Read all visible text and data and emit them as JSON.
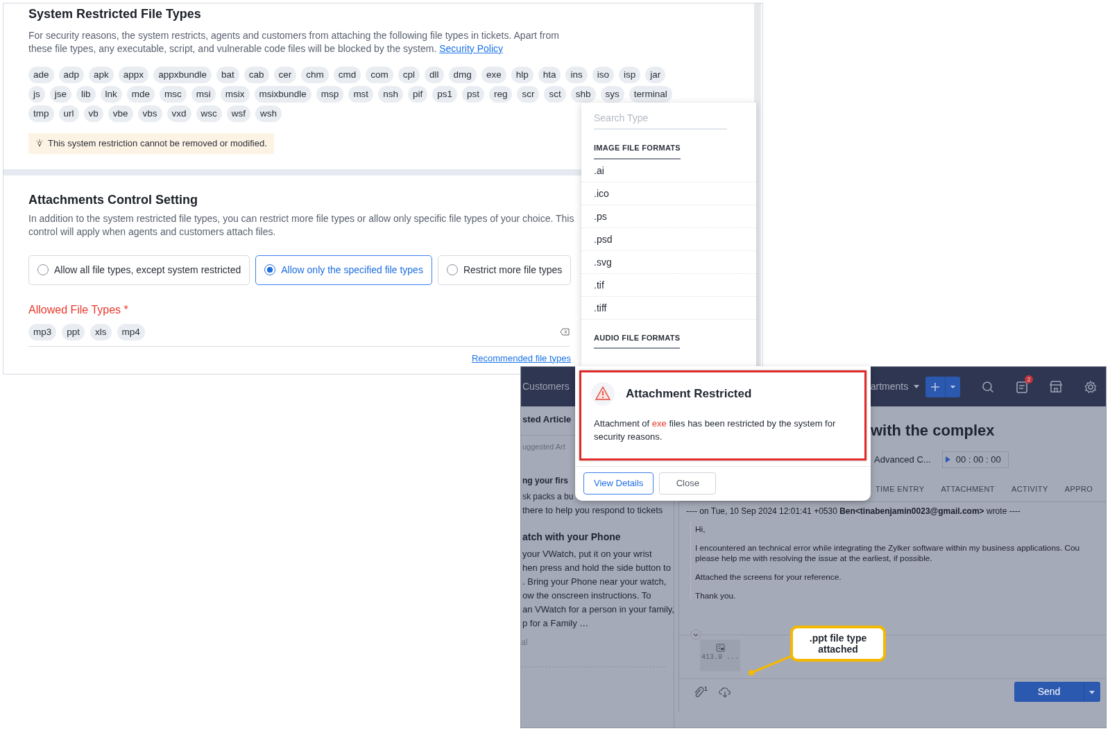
{
  "settings_panel": {
    "system_restricted": {
      "title": "System Restricted File Types",
      "description": "For security reasons, the system restricts, agents and customers from attaching the following file types in tickets. Apart from these file types, any executable, script, and vulnerable code files will be blocked by the system.",
      "link": "Security Policy",
      "file_type_rows": [
        [
          "ade",
          "adp",
          "apk",
          "appx",
          "appxbundle",
          "bat",
          "cab",
          "cer",
          "chm",
          "cmd",
          "com",
          "cpl",
          "dll",
          "dmg",
          "exe",
          "hlp",
          "hta",
          "ins",
          "iso",
          "isp",
          "jar"
        ],
        [
          "js",
          "jse",
          "lib",
          "lnk",
          "mde",
          "msc",
          "msi",
          "msix",
          "msixbundle",
          "msp",
          "mst",
          "nsh",
          "pif",
          "ps1",
          "pst",
          "reg",
          "scr",
          "sct",
          "shb",
          "sys",
          "terminal"
        ],
        [
          "tmp",
          "url",
          "vb",
          "vbe",
          "vbs",
          "vxd",
          "wsc",
          "wsf",
          "wsh"
        ]
      ],
      "notice": "This system restriction cannot be removed or modified."
    },
    "attachments_control": {
      "title": "Attachments Control Setting",
      "description": "In addition to the system restricted file types, you can restrict more file types or allow only specific file types of your choice. This control will apply when agents and customers attach files.",
      "options": [
        {
          "label": "Allow all file types, except system restricted",
          "selected": false
        },
        {
          "label": "Allow only the specified file types",
          "selected": true
        },
        {
          "label": "Restrict more file types",
          "selected": false
        }
      ],
      "allowed_label": "Allowed File Types",
      "required_mark": "*",
      "allowed_types": [
        "mp3",
        "ppt",
        "xls",
        "mp4"
      ],
      "recommended_link": "Recommended file types"
    }
  },
  "type_dropdown": {
    "placeholder": "Search Type",
    "groups": [
      {
        "heading": "IMAGE FILE FORMATS",
        "items": [
          ".ai",
          ".ico",
          ".ps",
          ".psd",
          ".svg",
          ".tif",
          ".tiff"
        ]
      },
      {
        "heading": "AUDIO FILE FORMATS"
      }
    ]
  },
  "ticket_window": {
    "nav_items": [
      "Customers",
      "artments"
    ],
    "notification_count": "2",
    "sidebar": {
      "heading": "sted Article",
      "search_placeholder": "uggested Art",
      "articles": [
        {
          "title": "ng your firs",
          "lines": [
            "sk packs a bu",
            "there to help you respond to tickets"
          ]
        },
        {
          "title": "atch with your Phone",
          "lines": [
            "your VWatch, put it on your wrist",
            "hen press and hold the side button to",
            ". Bring your Phone near your watch,",
            "ow the onscreen instructions. To",
            "an VWatch for a person in your family,",
            "p for a Family …"
          ]
        }
      ],
      "footer": "al"
    },
    "ticket_title": "with the complex",
    "field_value": "Advanced C...",
    "timer": "00 : 00 : 00",
    "tabs": [
      "TIME ENTRY",
      "ATTACHMENT",
      "ACTIVITY",
      "APPRO"
    ],
    "email": {
      "header": "---- on Tue, 10 Sep 2024 12:01:41 +0530 **Ben<tinabenjamin0023@gmail.com>** wrote ----",
      "paragraphs": [
        "Hi,",
        "I encountered an technical error while integrating the Zylker software within my business applications. Cou\nplease help me with resolving the issue at the earliest, if possible.",
        "Attached the screens for your reference.",
        "Thank you."
      ]
    },
    "attachment_size": "413.9 ...",
    "attachment_count": "1",
    "send_button": "Send"
  },
  "dialog": {
    "title": "Attachment Restricted",
    "message_start": "Attachment of",
    "restricted_type": "exe",
    "message_end": "files has been restricted by the system for security reasons.",
    "buttons": [
      {
        "label": "View Details",
        "kind": "primary"
      },
      {
        "label": "Close",
        "kind": "secondary"
      }
    ]
  },
  "callout": {
    "text": ".ppt file type attached"
  }
}
